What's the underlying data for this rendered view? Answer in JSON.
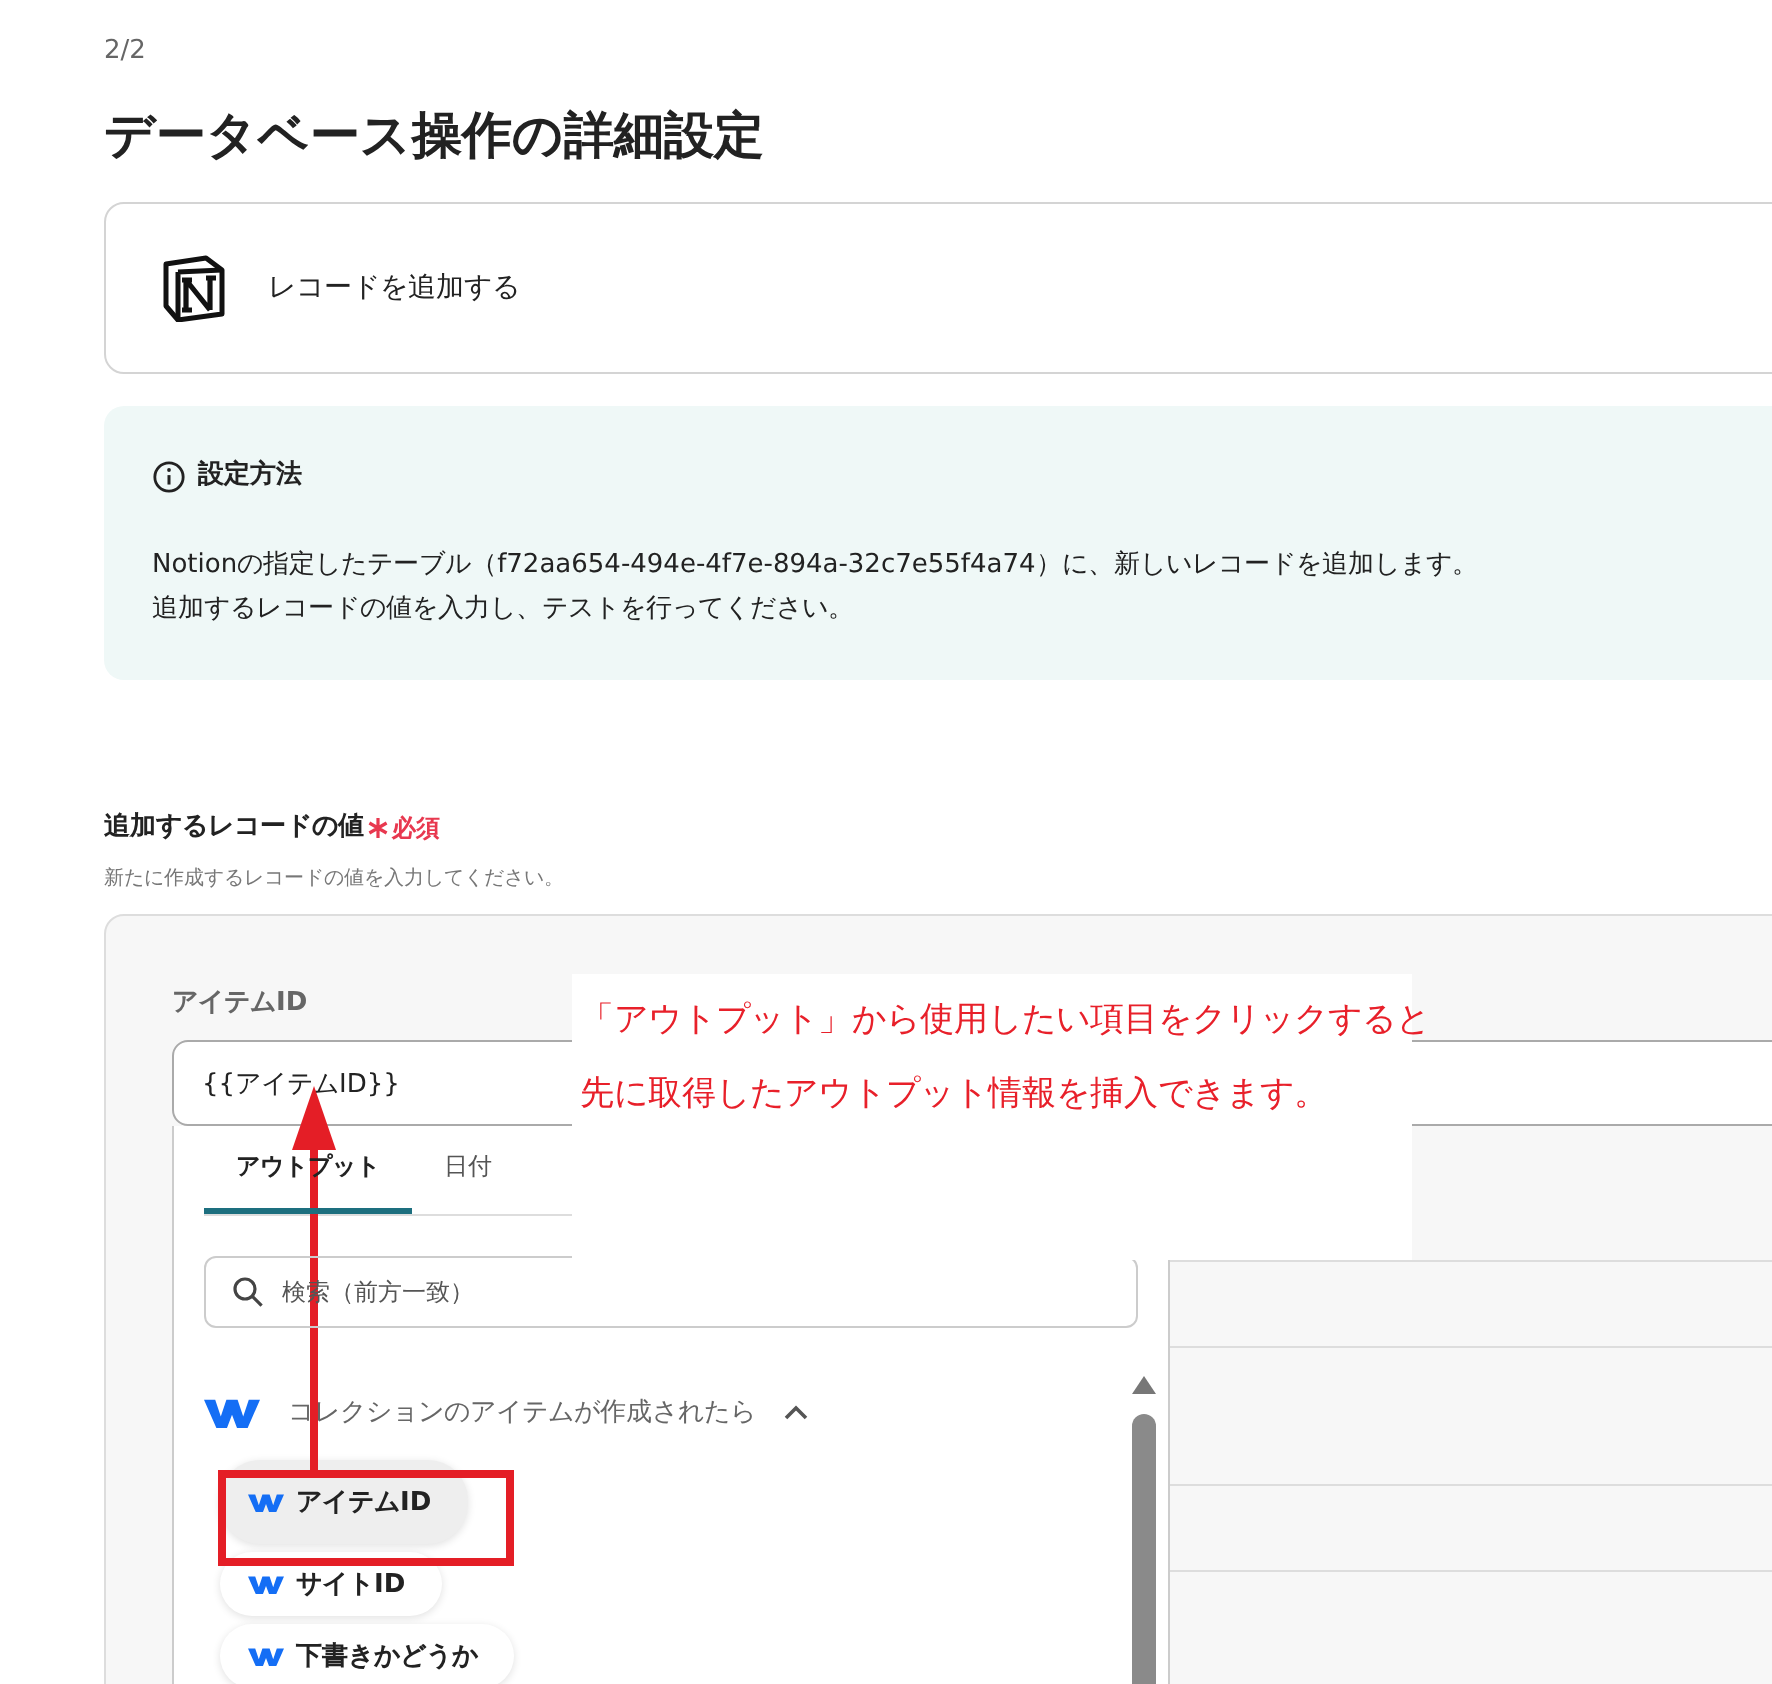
{
  "step": "2/2",
  "title": "データベース操作の詳細設定",
  "action": {
    "label": "レコードを追加する"
  },
  "info": {
    "heading": "設定方法",
    "lines": [
      "Notionの指定したテーブル（f72aa654-494e-4f7e-894a-32c7e55f4a74）に、新しいレコードを追加します。",
      "追加するレコードの値を入力し、テストを行ってください。"
    ]
  },
  "field": {
    "label": "追加するレコードの値",
    "required": "必須",
    "hint": "新たに作成するレコードの値を入力してください。"
  },
  "input": {
    "label": "アイテムID",
    "value": "{{アイテムID}}"
  },
  "picker": {
    "tabs": [
      {
        "label": "アウトプット",
        "selected": true
      },
      {
        "label": "日付",
        "selected": false
      }
    ],
    "search_placeholder": "検索（前方一致）",
    "group": {
      "title": "コレクションのアイテムが作成されたら",
      "expanded": true,
      "items": [
        {
          "label": "アイテムID",
          "highlighted": true
        },
        {
          "label": "サイトID",
          "highlighted": false
        },
        {
          "label": "下書きかどうか",
          "highlighted": false
        }
      ]
    }
  },
  "annotation": {
    "lines": [
      "「アウトプット」から使用したい項目をクリックすると",
      "先に取得したアウトプット情報を挿入できます。"
    ]
  }
}
